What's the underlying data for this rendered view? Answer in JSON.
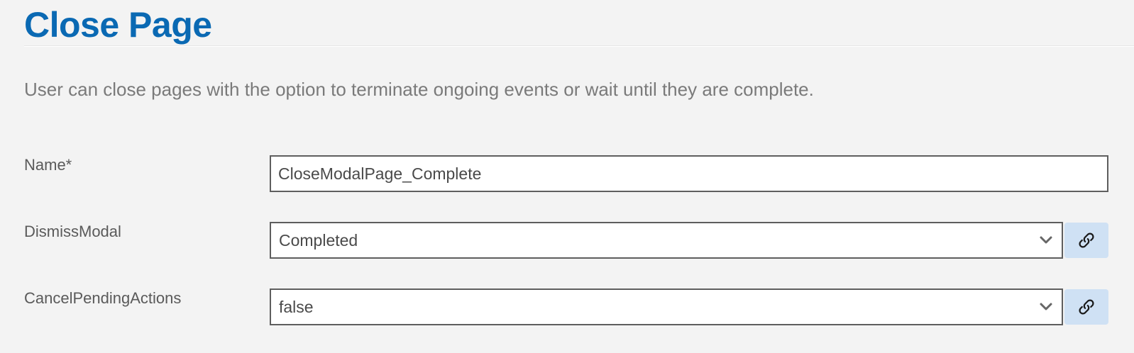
{
  "header": {
    "title": "Close Page",
    "description": "User can close pages with the option to terminate ongoing events or wait until they are complete."
  },
  "form": {
    "name": {
      "label": "Name*",
      "value": "CloseModalPage_Complete"
    },
    "dismiss_modal": {
      "label": "DismissModal",
      "selected": "Completed",
      "icon": "chevron-down-icon",
      "link_icon": "link-icon"
    },
    "cancel_pending_actions": {
      "label": "CancelPendingActions",
      "selected": "false",
      "icon": "chevron-down-icon",
      "link_icon": "link-icon"
    }
  },
  "colors": {
    "title": "#0a69b3",
    "background": "#f3f3f3",
    "link_button": "#cfe1f4",
    "input_border": "#5e5e5e"
  }
}
